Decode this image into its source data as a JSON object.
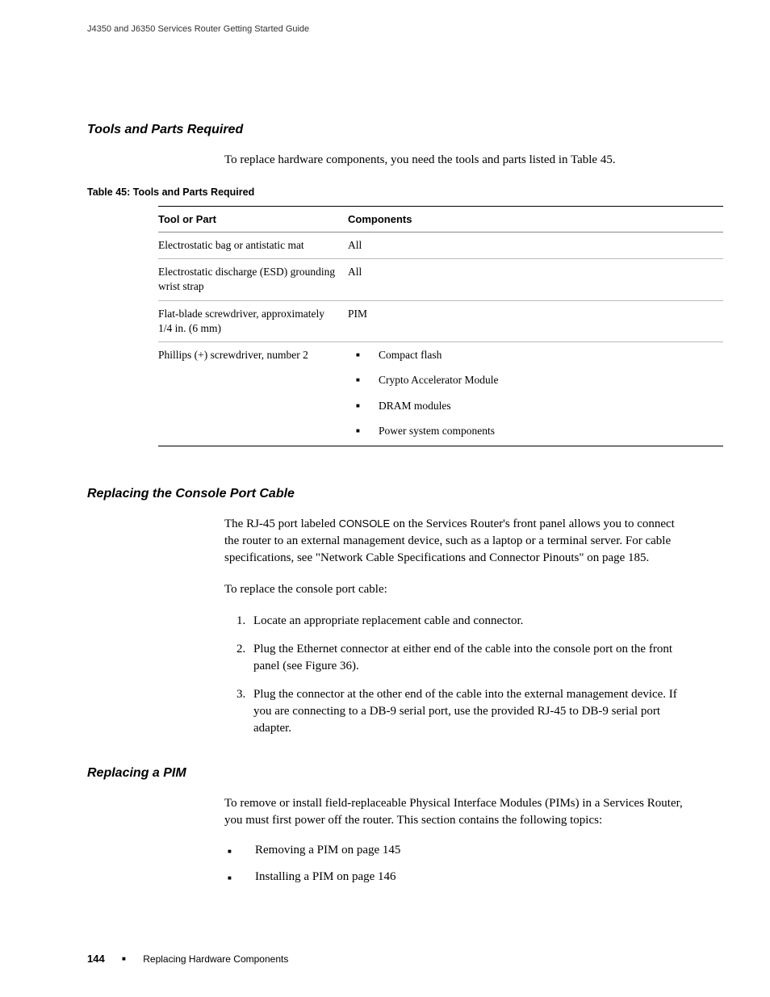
{
  "header": {
    "running_title": "J4350 and J6350 Services Router Getting Started Guide"
  },
  "section_tools": {
    "heading": "Tools and Parts Required",
    "intro": "To replace hardware components, you need the tools and parts listed in Table 45.",
    "table_caption": "Table 45: Tools and Parts Required",
    "columns": {
      "c0": "Tool or Part",
      "c1": "Components"
    },
    "rows": [
      {
        "tool": "Electrostatic bag or antistatic mat",
        "components_text": "All"
      },
      {
        "tool": "Electrostatic discharge (ESD) grounding wrist strap",
        "components_text": "All"
      },
      {
        "tool": "Flat-blade screwdriver, approximately 1/4 in. (6 mm)",
        "components_text": "PIM"
      },
      {
        "tool": "Phillips (+) screwdriver, number 2",
        "components_list": [
          "Compact flash",
          "Crypto Accelerator Module",
          "DRAM modules",
          "Power system components"
        ]
      }
    ]
  },
  "section_console": {
    "heading": "Replacing the Console Port Cable",
    "para_pre": "The RJ-45 port labeled ",
    "para_label": "CONSOLE",
    "para_post": " on the Services Router's front panel allows you to connect the router to an external management device, such as a laptop or a terminal server. For cable specifications, see \"Network Cable Specifications and Connector Pinouts\" on page 185.",
    "lead_in": "To replace the console port cable:",
    "steps": [
      "Locate an appropriate replacement cable and connector.",
      "Plug the Ethernet connector at either end of the cable into the console port on the front panel (see Figure 36).",
      "Plug the connector at the other end of the cable into the external management device. If you are connecting to a DB-9 serial port, use the provided RJ-45 to DB-9 serial port adapter."
    ]
  },
  "section_pim": {
    "heading": "Replacing a PIM",
    "intro": "To remove or install field-replaceable Physical Interface Modules (PIMs) in a Services Router, you must first power off the router. This section contains the following topics:",
    "topics": [
      "Removing a PIM on page 145",
      "Installing a PIM on page 146"
    ]
  },
  "footer": {
    "page_number": "144",
    "section_name": "Replacing Hardware Components"
  }
}
